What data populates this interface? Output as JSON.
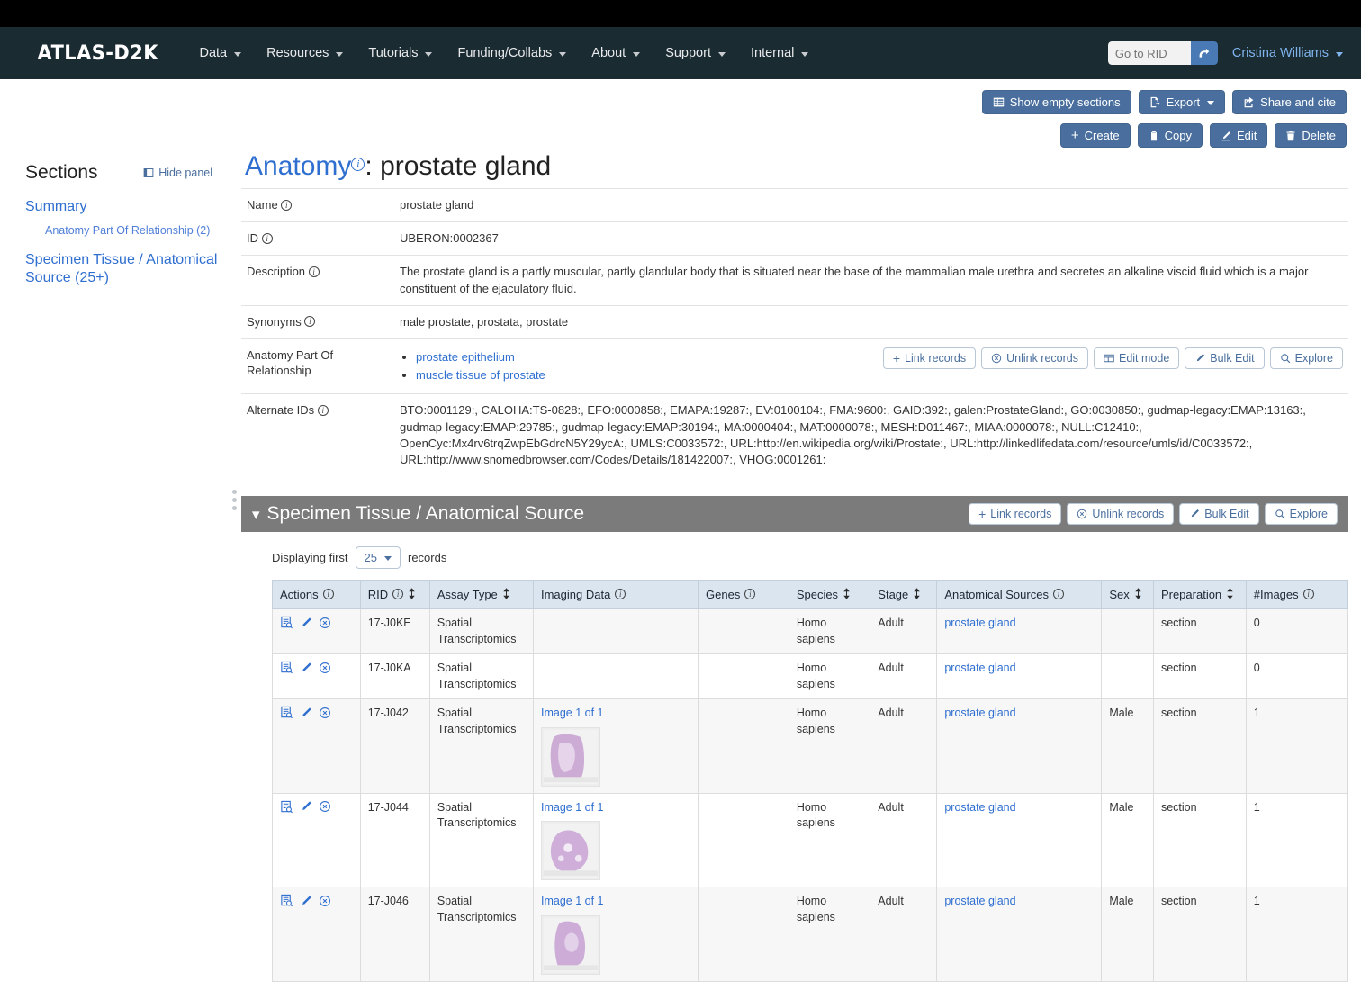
{
  "navbar": {
    "brand": "ATLAS-D2K",
    "items": [
      {
        "label": "Data"
      },
      {
        "label": "Resources"
      },
      {
        "label": "Tutorials"
      },
      {
        "label": "Funding/Collabs"
      },
      {
        "label": "About"
      },
      {
        "label": "Support"
      },
      {
        "label": "Internal"
      }
    ],
    "rid_placeholder": "Go to RID",
    "rid_value": "",
    "user": "Cristina Williams"
  },
  "toolbar": {
    "show_empty_sections": "Show empty sections",
    "export": "Export",
    "share_and_cite": "Share and cite",
    "create": "Create",
    "copy": "Copy",
    "edit": "Edit",
    "delete": "Delete"
  },
  "sidebar": {
    "title": "Sections",
    "hide_panel": "Hide panel",
    "items": [
      {
        "label": "Summary",
        "level": 1
      },
      {
        "label": "Anatomy Part Of Relationship (2)",
        "level": 2
      },
      {
        "label": "Specimen Tissue / Anatomical Source (25+)",
        "level": 1
      }
    ]
  },
  "record": {
    "entity": "Anatomy",
    "separator": ": ",
    "name": "prostate gland",
    "fields": [
      {
        "key": "Name",
        "info": true,
        "value": "prostate gland"
      },
      {
        "key": "ID",
        "info": true,
        "value": "UBERON:0002367"
      },
      {
        "key": "Description",
        "info": true,
        "value": "The prostate gland is a partly muscular, partly glandular body that is situated near the base of the mammalian male urethra and secretes an alkaline viscid fluid which is a major constituent of the ejaculatory fluid."
      },
      {
        "key": "Synonyms",
        "info": true,
        "value": "male prostate, prostata, prostate"
      }
    ],
    "part_of": {
      "key": "Anatomy Part Of Relationship",
      "links": [
        "prostate epithelium",
        "muscle tissue of prostate"
      ],
      "buttons": [
        "Link records",
        "Unlink records",
        "Edit mode",
        "Bulk Edit",
        "Explore"
      ]
    },
    "alternate_ids": {
      "key": "Alternate IDs",
      "info": true,
      "value": "BTO:0001129:, CALOHA:TS-0828:, EFO:0000858:, EMAPA:19287:, EV:0100104:, FMA:9600:, GAID:392:, galen:ProstateGland:, GO:0030850:, gudmap-legacy:EMAP:13163:, gudmap-legacy:EMAP:29785:, gudmap-legacy:EMAP:30194:, MA:0000404:, MAT:0000078:, MESH:D011467:, MIAA:0000078:, NULL:C12410:, OpenCyc:Mx4rv6trqZwpEbGdrcN5Y29ycA:, UMLS:C0033572:, URL:http://en.wikipedia.org/wiki/Prostate:, URL:http://linkedlifedata.com/resource/umls/id/C0033572:, URL:http://www.snomedbrowser.com/Codes/Details/181422007:, VHOG:0001261:"
    }
  },
  "section": {
    "title": "Specimen Tissue / Anatomical Source",
    "buttons": [
      "Link records",
      "Unlink records",
      "Bulk Edit",
      "Explore"
    ],
    "displaying_prefix": "Displaying first",
    "page_size": "25",
    "displaying_suffix": "records",
    "columns": [
      {
        "label": "Actions",
        "info": true,
        "sort": false
      },
      {
        "label": "RID",
        "info": true,
        "sort": true
      },
      {
        "label": "Assay Type",
        "info": false,
        "sort": true
      },
      {
        "label": "Imaging Data",
        "info": true,
        "sort": false
      },
      {
        "label": "Genes",
        "info": true,
        "sort": false
      },
      {
        "label": "Species",
        "info": false,
        "sort": true
      },
      {
        "label": "Stage",
        "info": false,
        "sort": true
      },
      {
        "label": "Anatomical Sources",
        "info": true,
        "sort": false
      },
      {
        "label": "Sex",
        "info": false,
        "sort": true
      },
      {
        "label": "Preparation",
        "info": false,
        "sort": true
      },
      {
        "label": "#Images",
        "info": true,
        "sort": false
      }
    ],
    "rows": [
      {
        "rid": "17-J0KE",
        "assay": "Spatial Transcriptomics",
        "imaging": "",
        "thumb": "none",
        "genes": "",
        "species": "Homo sapiens",
        "stage": "Adult",
        "anatomical": "prostate gland",
        "sex": "",
        "preparation": "section",
        "images": "0"
      },
      {
        "rid": "17-J0KA",
        "assay": "Spatial Transcriptomics",
        "imaging": "",
        "thumb": "none",
        "genes": "",
        "species": "Homo sapiens",
        "stage": "Adult",
        "anatomical": "prostate gland",
        "sex": "",
        "preparation": "section",
        "images": "0"
      },
      {
        "rid": "17-J042",
        "assay": "Spatial Transcriptomics",
        "imaging": "Image 1 of 1",
        "thumb": "tissue-a",
        "genes": "",
        "species": "Homo sapiens",
        "stage": "Adult",
        "anatomical": "prostate gland",
        "sex": "Male",
        "preparation": "section",
        "images": "1"
      },
      {
        "rid": "17-J044",
        "assay": "Spatial Transcriptomics",
        "imaging": "Image 1 of 1",
        "thumb": "tissue-b",
        "genes": "",
        "species": "Homo sapiens",
        "stage": "Adult",
        "anatomical": "prostate gland",
        "sex": "Male",
        "preparation": "section",
        "images": "1"
      },
      {
        "rid": "17-J046",
        "assay": "Spatial Transcriptomics",
        "imaging": "Image 1 of 1",
        "thumb": "tissue-c",
        "genes": "",
        "species": "Homo sapiens",
        "stage": "Adult",
        "anatomical": "prostate gland",
        "sex": "Male",
        "preparation": "section",
        "images": "1"
      }
    ]
  },
  "colors": {
    "navbar_bg": "#1b2b32",
    "primary": "#4a6f9e",
    "link": "#2f6fd0",
    "section_header_bg": "#7b7b7b",
    "table_header_bg": "#dae5f0"
  }
}
